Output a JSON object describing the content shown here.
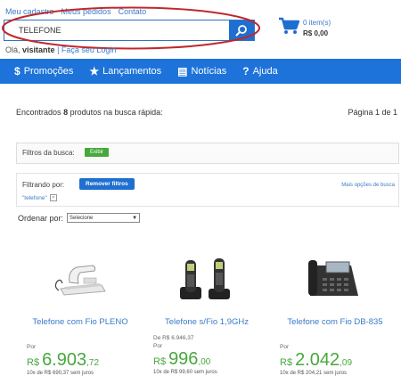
{
  "header": {
    "links": [
      "Meu cadastro",
      "Meus pedidos",
      "Contato"
    ],
    "search_value": "TELEFONE",
    "greeting_prefix": "Olá,",
    "greeting_user": "visitante",
    "greeting_links": "| Faça seu Login"
  },
  "cart": {
    "items": "0 item(s)",
    "total": "R$ 0,00"
  },
  "nav": [
    {
      "icon": "dollar-icon",
      "glyph": "$",
      "label": "Promoções"
    },
    {
      "icon": "star-icon",
      "glyph": "★",
      "label": "Lançamentos"
    },
    {
      "icon": "newspaper-icon",
      "glyph": "▤",
      "label": "Notícias"
    },
    {
      "icon": "question-icon",
      "glyph": "?",
      "label": "Ajuda"
    }
  ],
  "results": {
    "prefix": "Encontrados",
    "count": "8",
    "suffix": "produtos na busca rápida:",
    "page": "Página 1 de 1"
  },
  "filters": {
    "label": "Filtros da busca:",
    "show_button": "Exibir",
    "filtering_label": "Filtrando por:",
    "remove_button": "Remover filtros",
    "more_options": "Mais opções de busca",
    "active_tag": "\"telefone\""
  },
  "sort": {
    "label": "Ordenar por:",
    "selected": "Selecione"
  },
  "products": [
    {
      "name": "Telefone com Fio PLENO",
      "old_price": "",
      "por": "Por",
      "currency": "R$",
      "price_int": "6.903",
      "price_cents": ",72",
      "installments": "10x de R$ 690,37 sem juros"
    },
    {
      "name": "Telefone s/Fio 1,9GHz",
      "old_price": "De  R$ 6.946,37",
      "por": "Por",
      "currency": "R$",
      "price_int": "996",
      "price_cents": ",00",
      "installments": "10x de R$ 99,60 sem juros"
    },
    {
      "name": "Telefone com Fio DB-835",
      "old_price": "",
      "por": "Por",
      "currency": "R$",
      "price_int": "2.042",
      "price_cents": ",09",
      "installments": "10x de R$ 204,21 sem juros"
    }
  ],
  "colors": {
    "brand_blue": "#1d73d9",
    "price_green": "#47a83c",
    "highlight_ellipse": "#c0282d"
  }
}
